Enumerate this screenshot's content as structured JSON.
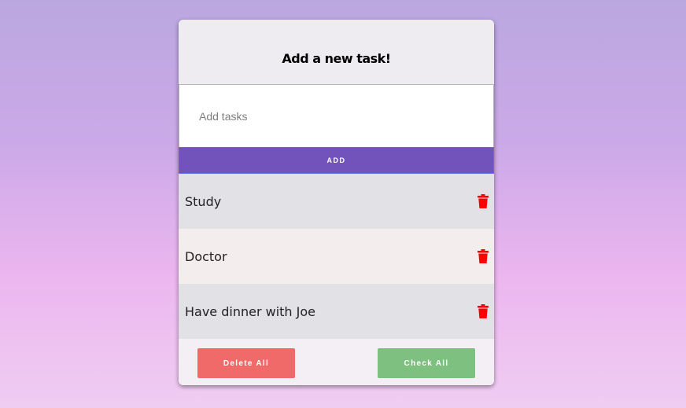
{
  "header": {
    "title": "Add a new task!"
  },
  "input": {
    "placeholder": "Add tasks",
    "value": ""
  },
  "add_button": {
    "label": "ADD"
  },
  "tasks": [
    {
      "text": "Study",
      "icon": "trash-icon"
    },
    {
      "text": "Doctor",
      "icon": "trash-icon"
    },
    {
      "text": "Have dinner with Joe",
      "icon": "trash-icon"
    }
  ],
  "footer": {
    "delete_all_label": "Delete All",
    "check_all_label": "Check All"
  },
  "colors": {
    "accent": "#7153bb",
    "delete": "#f06a6a",
    "check": "#7ec07f",
    "trash": "#ff0000"
  }
}
